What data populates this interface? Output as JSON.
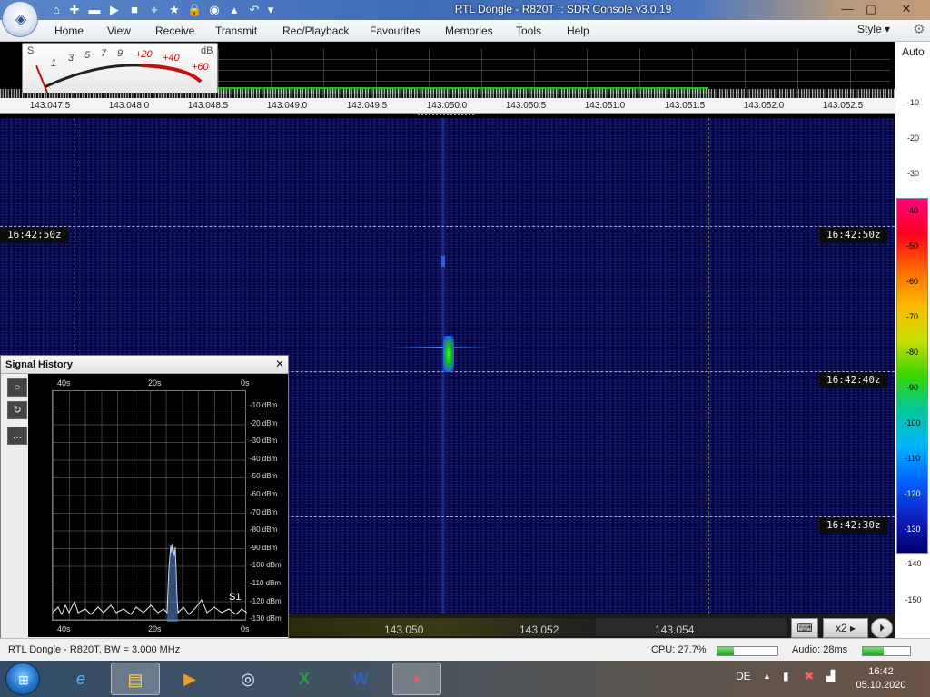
{
  "window": {
    "title": "RTL Dongle - R820T :: SDR Console v3.0.19",
    "controls": {
      "minimize": "—",
      "maximize": "▢",
      "close": "✕"
    }
  },
  "app_button": {
    "icon": "sdr-console-logo-icon",
    "glyph": "◈"
  },
  "quick_access": [
    {
      "icon": "home-icon",
      "glyph": "⌂"
    },
    {
      "icon": "lifebuoy-icon",
      "glyph": "✚"
    },
    {
      "icon": "folder-icon",
      "glyph": "▬"
    },
    {
      "icon": "play-icon",
      "glyph": "▶"
    },
    {
      "icon": "stop-icon",
      "glyph": "■"
    },
    {
      "icon": "add-icon",
      "glyph": "+"
    },
    {
      "icon": "star-icon",
      "glyph": "★"
    },
    {
      "icon": "lock-icon",
      "glyph": "🔒"
    },
    {
      "icon": "camera-icon",
      "glyph": "◉"
    },
    {
      "icon": "drop-icon",
      "glyph": "▴"
    },
    {
      "icon": "undo-icon",
      "glyph": "↶"
    },
    {
      "icon": "customize-icon",
      "glyph": "▾"
    }
  ],
  "menu": [
    "Home",
    "View",
    "Receive",
    "Transmit",
    "Rec/Playback",
    "Favourites",
    "Memories",
    "Tools",
    "Help"
  ],
  "style_menu": {
    "label": "Style",
    "arrow": "▾",
    "gear_glyph": "⚙"
  },
  "smeter": {
    "unit_s": "S",
    "unit_db": "dB",
    "s_labels": [
      "1",
      "3",
      "5",
      "7",
      "9"
    ],
    "db_labels": [
      "+20",
      "+40",
      "+60"
    ]
  },
  "frequency_axis": [
    "143.047.5",
    "143.048.0",
    "143.048.5",
    "143.049.0",
    "143.049.5",
    "143.050.0",
    "143.050.5",
    "143.051.0",
    "143.051.5",
    "143.052.0",
    "143.052.5"
  ],
  "waterfall": {
    "time_tags": [
      "16:42:50z",
      "16:42:40z",
      "16:42:30z"
    ]
  },
  "bottom_bar": {
    "freq_labels": [
      "143.050",
      "143.052",
      "143.054"
    ],
    "zoom": "x2",
    "zoom_arrow": "▸",
    "keyboard_glyph": "⌨",
    "next_glyph": "⏵"
  },
  "right_scale": {
    "auto_label": "Auto",
    "ticks": [
      "-10",
      "-20",
      "-30",
      "-40",
      "-50",
      "-60",
      "-70",
      "-80",
      "-90",
      "-100",
      "-110",
      "-120",
      "-130",
      "-140",
      "-150"
    ]
  },
  "signal_history": {
    "title": "Signal History",
    "close": "✕",
    "side_buttons": [
      "○",
      "↻",
      "…"
    ],
    "top_labels": [
      "40s",
      "20s",
      "0s"
    ],
    "bottom_labels": [
      "40s",
      "20s",
      "0s"
    ],
    "dbm_labels": [
      "-10 dBm",
      "-20 dBm",
      "-30 dBm",
      "-40 dBm",
      "-50 dBm",
      "-60 dBm",
      "-70 dBm",
      "-80 dBm",
      "-90 dBm",
      "-100 dBm",
      "-110 dBm",
      "-120 dBm",
      "-130 dBm"
    ],
    "s_reading": "S1"
  },
  "status": {
    "device": "RTL Dongle - R820T, BW = 3.000 MHz",
    "cpu": "CPU: 27.7%",
    "cpu_level": 0.277,
    "audio": "Audio: 28ms",
    "audio_level": 0.45
  },
  "taskbar": {
    "start_glyph": "⊞",
    "apps": [
      {
        "name": "internet-explorer-icon",
        "glyph": "e"
      },
      {
        "name": "file-explorer-icon",
        "glyph": "▤"
      },
      {
        "name": "media-player-icon",
        "glyph": "▶"
      },
      {
        "name": "chrome-icon",
        "glyph": "◎"
      },
      {
        "name": "excel-icon",
        "glyph": "X"
      },
      {
        "name": "word-icon",
        "glyph": "W"
      },
      {
        "name": "sdr-console-icon",
        "glyph": "⌖"
      }
    ],
    "language": "DE",
    "tray": {
      "arrow": "▲",
      "power": "▮",
      "network": "✖",
      "signal": "▟"
    },
    "time": "16:42",
    "date": "05.10.2020"
  }
}
